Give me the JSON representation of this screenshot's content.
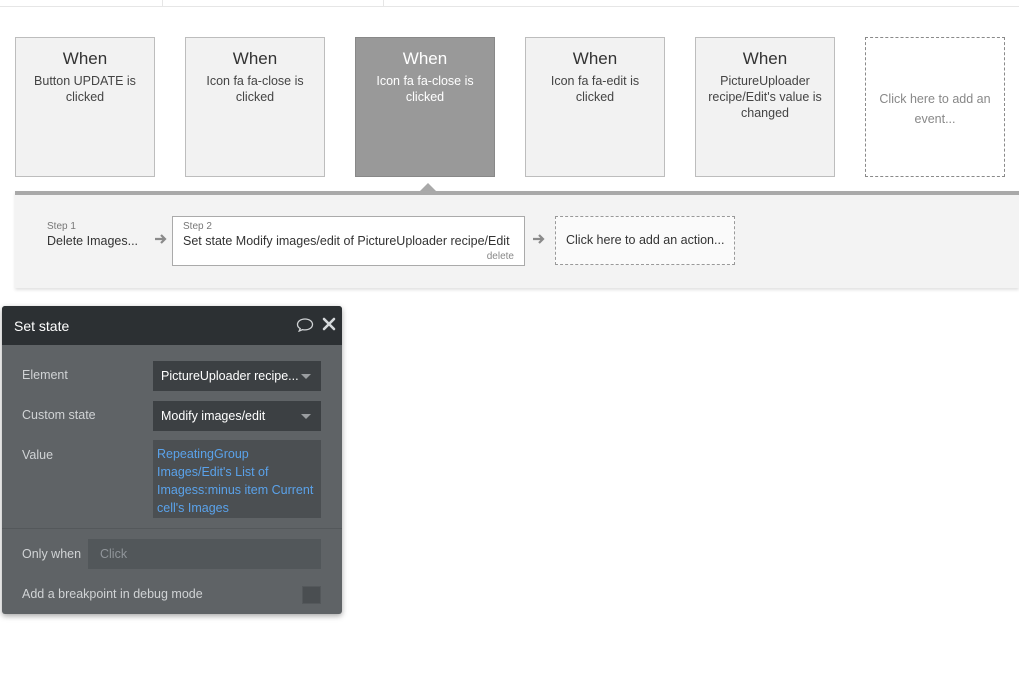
{
  "events": [
    {
      "when": "When",
      "desc": "Button UPDATE is clicked",
      "selected": false
    },
    {
      "when": "When",
      "desc": "Icon fa fa-close is clicked",
      "selected": false
    },
    {
      "when": "When",
      "desc": "Icon fa fa-close is clicked",
      "selected": true
    },
    {
      "when": "When",
      "desc": "Icon fa fa-edit is clicked",
      "selected": false
    },
    {
      "when": "When",
      "desc": "PictureUploader recipe/Edit's value is changed",
      "selected": false
    }
  ],
  "add_event_label": "Click here to add an event...",
  "steps": [
    {
      "num": "Step 1",
      "title": "Delete Images..."
    },
    {
      "num": "Step 2",
      "title": "Set state Modify images/edit of PictureUploader recipe/Edit",
      "delete_label": "delete"
    }
  ],
  "add_action_label": "Click here to add an action...",
  "panel": {
    "title": "Set state",
    "element_label": "Element",
    "element_value": "PictureUploader recipe...",
    "custom_state_label": "Custom state",
    "custom_state_value": "Modify images/edit",
    "value_label": "Value",
    "value_expression": "RepeatingGroup Images/Edit's List of Imagess:minus item Current cell's Images",
    "only_when_label": "Only when",
    "only_when_placeholder": "Click",
    "breakpoint_label": "Add a breakpoint in debug mode"
  },
  "colors": {
    "selected_card": "#999999",
    "panel_bg": "#5f6366",
    "panel_header": "#2c3033",
    "expression_link": "#5aa2ea"
  }
}
